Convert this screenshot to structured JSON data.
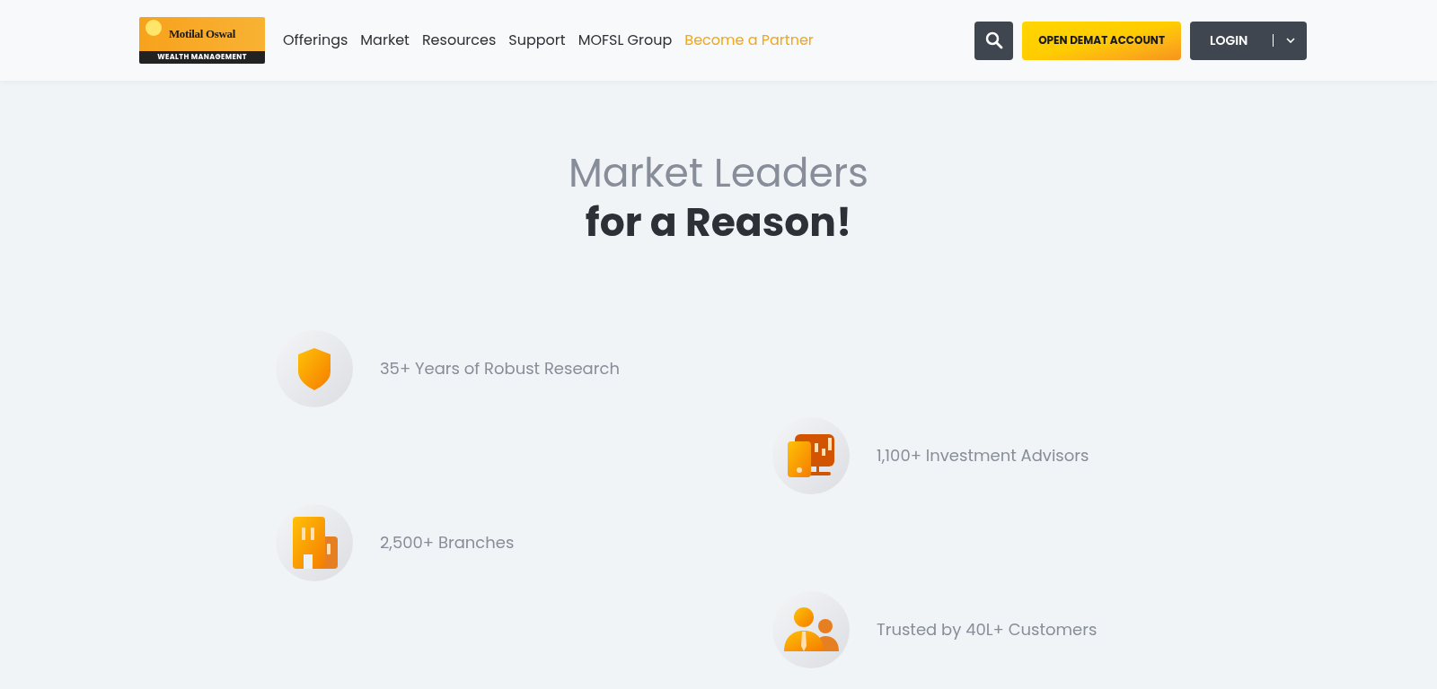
{
  "header": {
    "logo": {
      "name": "Motilal Oswal",
      "tagline": "WEALTH MANAGEMENT"
    },
    "nav": [
      {
        "label": "Offerings",
        "highlighted": false
      },
      {
        "label": "Market",
        "highlighted": false
      },
      {
        "label": "Resources",
        "highlighted": false
      },
      {
        "label": "Support",
        "highlighted": false
      },
      {
        "label": "MOFSL Group",
        "highlighted": false
      },
      {
        "label": "Become a Partner",
        "highlighted": true
      }
    ],
    "open_account_button": "OPEN DEMAT ACCOUNT",
    "login_button": "LOGIN"
  },
  "section": {
    "title_line_1": "Market Leaders",
    "title_line_2": "for a Reason!",
    "stats": [
      {
        "kind": "shield",
        "label": "35+ Years of Robust Research"
      },
      {
        "kind": "desktop",
        "label": "1,100+ Investment Advisors"
      },
      {
        "kind": "building",
        "label": "2,500+ Branches"
      },
      {
        "kind": "people",
        "label": "Trusted by 40L+ Customers"
      }
    ]
  }
}
